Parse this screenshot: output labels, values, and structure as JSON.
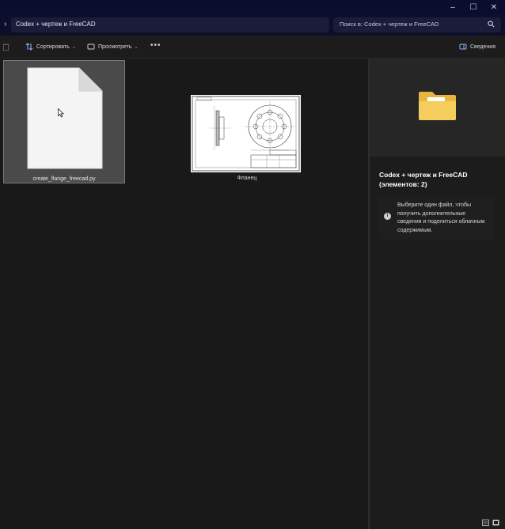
{
  "window": {
    "controls": {
      "minimize": "–",
      "maximize": "☐",
      "close": "✕"
    }
  },
  "address": {
    "breadcrumb": "Codex + чертеж и FreeCAD",
    "search_placeholder": "Поиск в: Codex + чертеж и FreeCAD"
  },
  "toolbar": {
    "sort_label": "Сортировать",
    "view_label": "Просмотреть",
    "more_label": "•••",
    "details_label": "Сведения"
  },
  "files": [
    {
      "name": "create_flange_freecad.py",
      "icon": "document-icon",
      "selected": true
    },
    {
      "name": "Фланец",
      "icon": "drawing-thumbnail"
    }
  ],
  "details": {
    "title": "Codex + чертеж и FreeCAD (элементов: 2)",
    "info_icon": "i",
    "info_text": "Выберите один файл, чтобы получить дополнительные сведения и поделиться облачным содержимым."
  },
  "colors": {
    "titlebar": "#0b0d2e",
    "background": "#191919",
    "selection": "#4a4a4a",
    "folder": "#f2c453"
  }
}
